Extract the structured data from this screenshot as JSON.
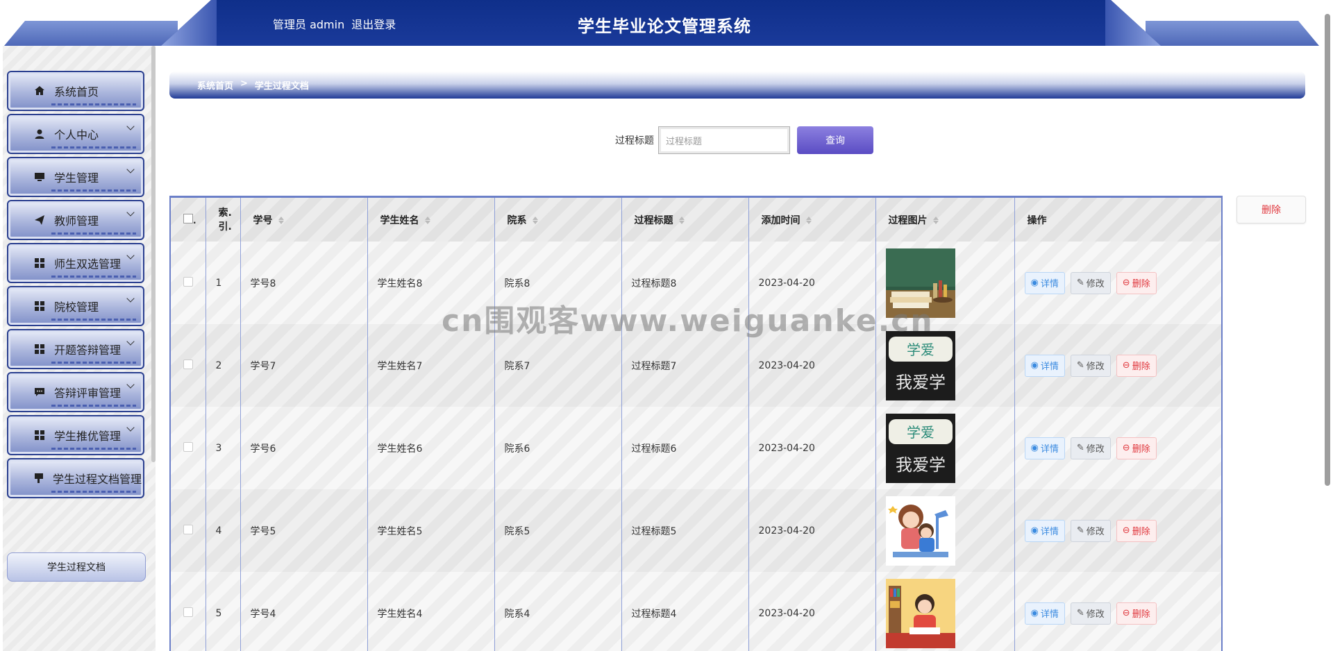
{
  "header": {
    "user_role": "管理员 admin",
    "logout": "退出登录",
    "title": "学生毕业论文管理系统"
  },
  "sidebar": {
    "items": [
      {
        "label": "系统首页",
        "icon": "home-icon"
      },
      {
        "label": "个人中心",
        "icon": "user-icon"
      },
      {
        "label": "学生管理",
        "icon": "monitor-icon"
      },
      {
        "label": "教师管理",
        "icon": "send-icon"
      },
      {
        "label": "师生双选管理",
        "icon": "grid-icon"
      },
      {
        "label": "院校管理",
        "icon": "grid-icon"
      },
      {
        "label": "开题答辩管理",
        "icon": "grid-icon"
      },
      {
        "label": "答辩评审管理",
        "icon": "chat-icon"
      },
      {
        "label": "学生推优管理",
        "icon": "grid-icon"
      },
      {
        "label": "学生过程文档管理",
        "icon": "flag-icon"
      }
    ],
    "submenu": "学生过程文档"
  },
  "breadcrumb": {
    "home": "系统首页",
    "sep": ">",
    "current": "学生过程文档"
  },
  "search": {
    "label": "过程标题",
    "placeholder": "过程标题",
    "button": "查询"
  },
  "toolbar": {
    "delete": "删除"
  },
  "table": {
    "columns": [
      "索引",
      "学号",
      "学生姓名",
      "院系",
      "过程标题",
      "添加时间",
      "过程图片",
      "操作"
    ],
    "index_header_l1": "索.",
    "index_header_l2": "引.",
    "actions": {
      "detail": "详情",
      "edit": "修改",
      "delete": "删除"
    },
    "rows": [
      {
        "index": "1",
        "xuehao": "学号8",
        "name": "学生姓名8",
        "dept": "院系8",
        "title": "过程标题8",
        "date": "2023-04-20",
        "image": "books-chalkboard"
      },
      {
        "index": "2",
        "xuehao": "学号7",
        "name": "学生姓名7",
        "dept": "院系7",
        "title": "过程标题7",
        "date": "2023-04-20",
        "image": "chalk-writing"
      },
      {
        "index": "3",
        "xuehao": "学号6",
        "name": "学生姓名6",
        "dept": "院系6",
        "title": "过程标题6",
        "date": "2023-04-20",
        "image": "chalk-writing"
      },
      {
        "index": "4",
        "xuehao": "学号5",
        "name": "学生姓名5",
        "dept": "院系5",
        "title": "过程标题5",
        "date": "2023-04-20",
        "image": "mother-child-cartoon"
      },
      {
        "index": "5",
        "xuehao": "学号4",
        "name": "学生姓名4",
        "dept": "院系4",
        "title": "过程标题4",
        "date": "2023-04-20",
        "image": "boy-reading-cartoon"
      }
    ]
  },
  "watermark": "cn围观客www.weiguanke.cn"
}
